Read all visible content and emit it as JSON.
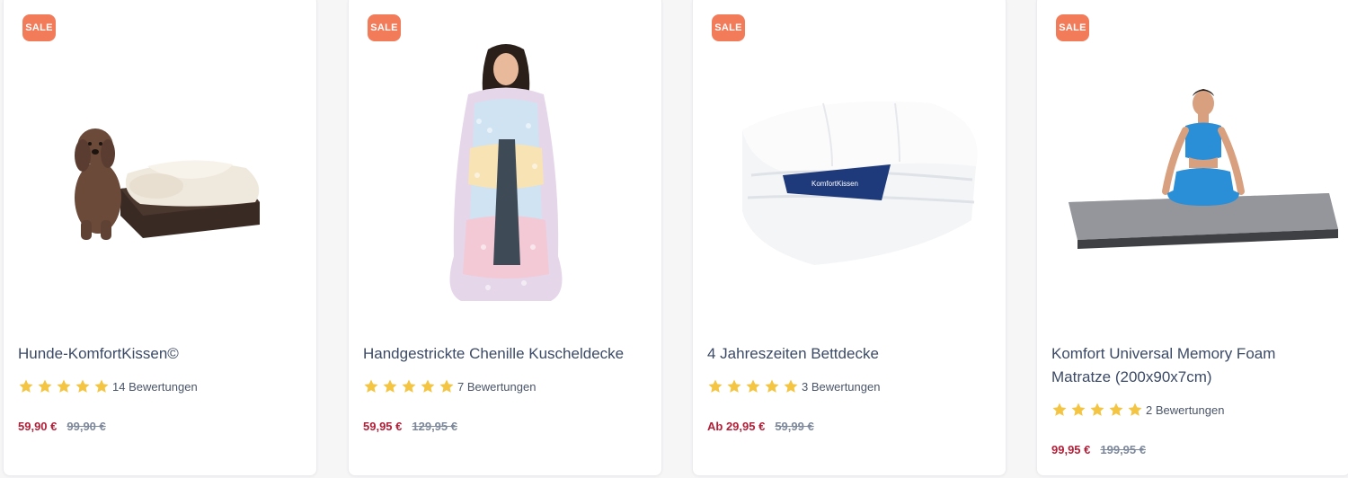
{
  "products": [
    {
      "badge": "SALE",
      "title": "Hunde-KomfortKissen©",
      "reviews": "14 Bewertungen",
      "price": "59,90 €",
      "old_price": "99,90 €",
      "stars": 5
    },
    {
      "badge": "SALE",
      "title": "Handgestrickte Chenille Kuscheldecke",
      "reviews": "7 Bewertungen",
      "price": "59,95 €",
      "old_price": "129,95 €",
      "stars": 5
    },
    {
      "badge": "SALE",
      "title": "4 Jahreszeiten Bettdecke",
      "reviews": "3 Bewertungen",
      "price": "Ab 29,95 €",
      "old_price": "59,99 €",
      "stars": 5
    },
    {
      "badge": "SALE",
      "title": "Komfort Universal Memory Foam Matratze (200x90x7cm)",
      "reviews": "2 Bewertungen",
      "price": "99,95 €",
      "old_price": "199,95 €",
      "stars": 5
    }
  ],
  "colors": {
    "badge": "#f27b5a",
    "price": "#b21f38",
    "old_price": "#7d889b",
    "star": "#f4c542",
    "title": "#3b4a66"
  },
  "icons": {
    "star": "star-icon"
  },
  "brand_label": "KomfortKissen"
}
